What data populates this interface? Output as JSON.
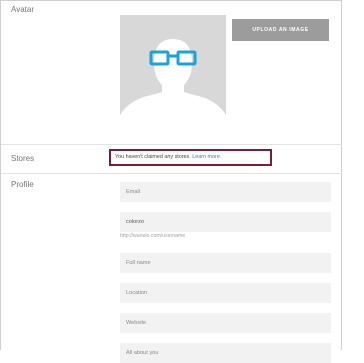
{
  "sections": {
    "avatar_label": "Avatar",
    "stores_label": "Stores",
    "profile_label": "Profile"
  },
  "avatar": {
    "upload_button": "UPLOAD AN IMAGE"
  },
  "stores": {
    "message": "You haven't claimed any stores.",
    "link": "Learn more."
  },
  "profile": {
    "email_placeholder": "Email",
    "username_value": "colorzo",
    "url_hint": "http://wanelo.com/username",
    "fullname_placeholder": "Full name",
    "location_placeholder": "Location",
    "website_placeholder": "Website",
    "about_placeholder": "All about you"
  },
  "colors": {
    "highlight_border": "#7a1e36",
    "link": "#3a7bbf",
    "glasses": "#1aa3d9"
  }
}
